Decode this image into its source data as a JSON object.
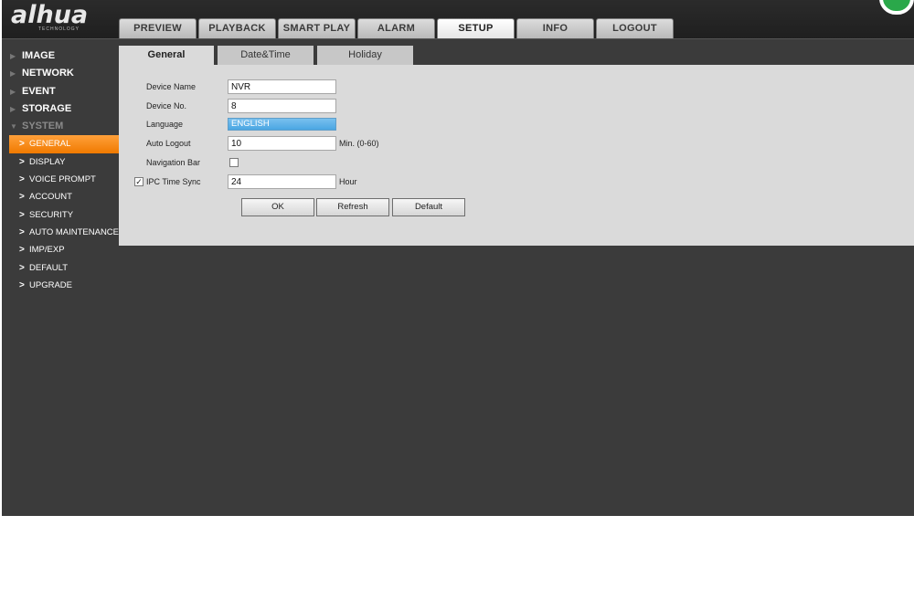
{
  "brand": {
    "logo_text": "alhua",
    "logo_sub": "TECHNOLOGY"
  },
  "topnav": {
    "tabs": [
      {
        "label": "PREVIEW"
      },
      {
        "label": "PLAYBACK"
      },
      {
        "label": "SMART PLAY"
      },
      {
        "label": "ALARM"
      },
      {
        "label": "SETUP",
        "active": true
      },
      {
        "label": "INFO"
      },
      {
        "label": "LOGOUT"
      }
    ]
  },
  "sidebar": {
    "menus": [
      "IMAGE",
      "NETWORK",
      "EVENT",
      "STORAGE",
      "SYSTEM"
    ],
    "system_items": [
      "GENERAL",
      "DISPLAY",
      "VOICE PROMPT",
      "ACCOUNT",
      "SECURITY",
      "AUTO MAINTENANCE",
      "IMP/EXP",
      "DEFAULT",
      "UPGRADE"
    ],
    "active_item": "GENERAL"
  },
  "subtabs": [
    "General",
    "Date&Time",
    "Holiday"
  ],
  "form": {
    "device_name": {
      "label": "Device Name",
      "value": "NVR"
    },
    "device_no": {
      "label": "Device No.",
      "value": "8"
    },
    "language": {
      "label": "Language",
      "value": "ENGLISH"
    },
    "auto_logout": {
      "label": "Auto Logout",
      "value": "10",
      "unit": "Min. (0-60)"
    },
    "navigation_bar": {
      "label": "Navigation Bar",
      "checked": false
    },
    "ipc_time_sync": {
      "label": "IPC Time Sync",
      "checked": true,
      "value": "24",
      "unit": "Hour"
    }
  },
  "buttons": {
    "ok": "OK",
    "refresh": "Refresh",
    "default": "Default"
  },
  "colors": {
    "accent": "#f58a1f",
    "select": "#5aaee6",
    "background": "#3b3b3b",
    "panel": "#dadada"
  }
}
